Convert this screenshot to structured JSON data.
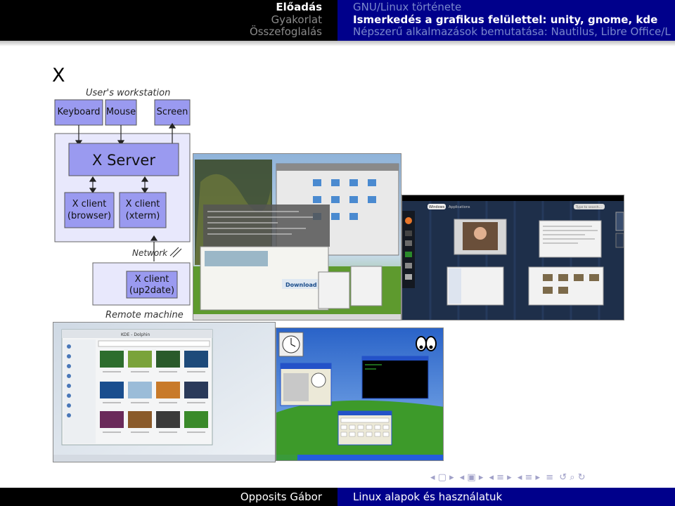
{
  "header": {
    "sections": [
      {
        "label": "Előadás",
        "active": true
      },
      {
        "label": "Gyakorlat",
        "active": false
      },
      {
        "label": "Összefoglalás",
        "active": false
      }
    ],
    "subsections": [
      {
        "label": "GNU/Linux története",
        "active": false
      },
      {
        "label": "Ismerkedés a grafikus felülettel: unity, gnome, kde",
        "active": true
      },
      {
        "label": "Népszerű alkalmazások bemutatása: Nautilus, Libre Office/L",
        "active": false
      }
    ]
  },
  "frame": {
    "title": "X"
  },
  "diagram": {
    "workstation_label": "User's workstation",
    "keyboard": "Keyboard",
    "mouse": "Mouse",
    "screen": "Screen",
    "x_server": "X Server",
    "client_browser_line1": "X client",
    "client_browser_line2": "(browser)",
    "client_xterm_line1": "X client",
    "client_xterm_line2": "(xterm)",
    "network_label": "Network",
    "client_remote_line1": "X client",
    "client_remote_line2": "(up2date)",
    "remote_label": "Remote machine"
  },
  "screenshots": {
    "compiz": {
      "download_text": "Download X"
    },
    "gnome": {
      "tab_windows": "Windows",
      "tab_apps": "Applications",
      "search": "Type to search..."
    },
    "kde": {
      "title": "KDE - Dolphin"
    },
    "xp": {}
  },
  "footer": {
    "author": "Opposits Gábor",
    "course": "Linux alapok és használatuk"
  },
  "colors": {
    "header_left": "#000000",
    "header_right": "#00008b",
    "diagram_fill": "#e8e8fc",
    "diagram_box": "#9a9af0"
  }
}
